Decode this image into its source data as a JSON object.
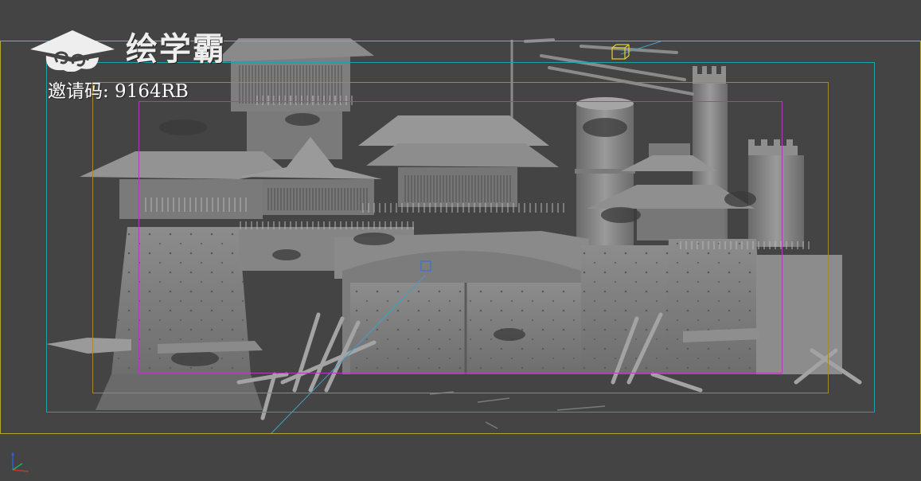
{
  "viewport": {
    "background": "#444444",
    "frame_colors": {
      "outer": "#b8a437",
      "safe_action": "#1fa3a8",
      "safe_title": "#a38a2a",
      "region": "#b03cb8"
    }
  },
  "watermark": {
    "brand_text": "绘学霸",
    "icon": "cloud-cap-logo-icon",
    "invite_text": "邀请码: 9164RB"
  },
  "gizmo": {
    "icon": "xyz-axis-icon",
    "x_color": "#c0392b",
    "y_color": "#27ae60",
    "z_color": "#2e5fd0"
  }
}
